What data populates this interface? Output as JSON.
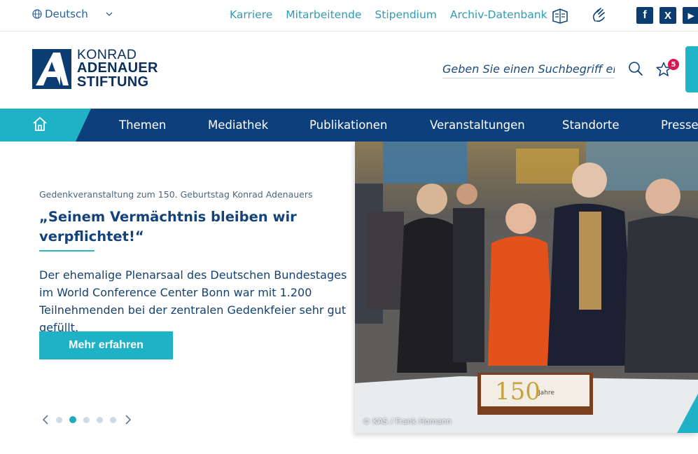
{
  "topbar": {
    "language": "Deutsch",
    "links": [
      "Karriere",
      "Mitarbeitende",
      "Stipendium",
      "Archiv-Datenbank"
    ],
    "icons": [
      "easy-read-icon",
      "sign-language-icon"
    ],
    "social": [
      {
        "name": "facebook-icon",
        "glyph": "f"
      },
      {
        "name": "x-icon",
        "glyph": "X"
      },
      {
        "name": "youtube-icon",
        "glyph": "▶"
      }
    ]
  },
  "logo": {
    "line1": "KONRAD",
    "line2": "ADENAUER",
    "line3": "STIFTUNG"
  },
  "search": {
    "placeholder": "Geben Sie einen Suchbegriff ein.",
    "favorites_count": "5"
  },
  "nav": {
    "items": [
      "Themen",
      "Mediathek",
      "Publikationen",
      "Veranstaltungen",
      "Standorte",
      "Presse"
    ]
  },
  "hero": {
    "kicker": "Gedenkveranstaltung zum 150. Geburtstag Konrad Adenauers",
    "headline": "„Seinem Vermächtnis bleiben wir verpflichtet!“",
    "body": "Der ehemalige Plenarsaal des Deutschen Bundestages im World Conference Center Bonn war mit 1.200 Teilnehmenden bei der zentralen Gedenkfeier sehr gut gefüllt.",
    "cta": "Mehr erfahren",
    "slide_count": 5,
    "active_slide": 2,
    "image_credit": "© KAS / Frank Homann",
    "cake_text": "150 Jahre"
  },
  "colors": {
    "navy": "#0d3f7c",
    "teal": "#1fb1c5",
    "badge": "#d6174f"
  }
}
